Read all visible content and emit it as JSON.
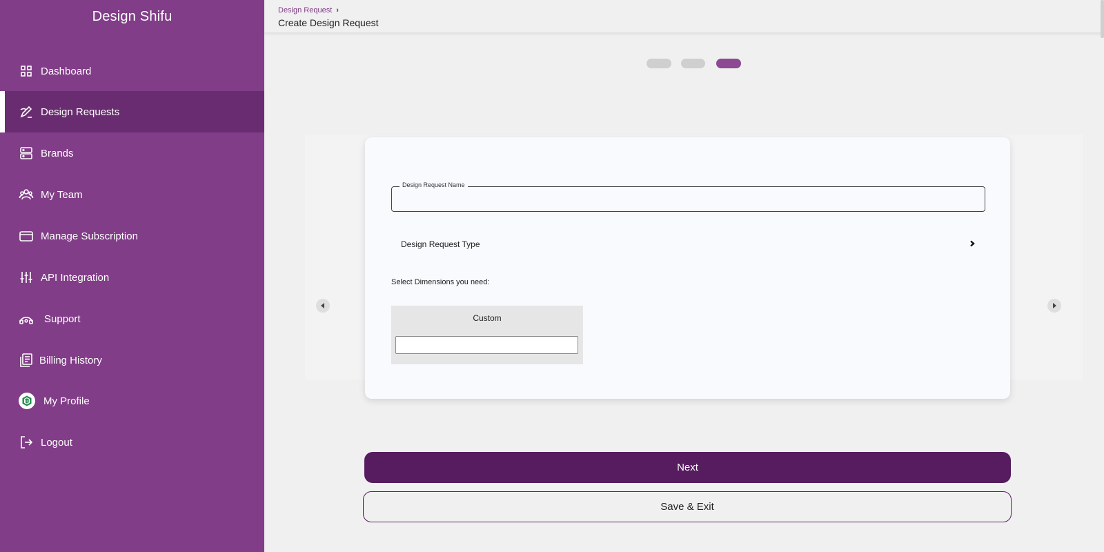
{
  "app": {
    "brand": "Design Shifu"
  },
  "sidebar": {
    "items": [
      {
        "label": "Dashboard",
        "icon": "grid-icon"
      },
      {
        "label": "Design Requests",
        "icon": "pen-icon",
        "active": true
      },
      {
        "label": "Brands",
        "icon": "server-icon"
      },
      {
        "label": "My Team",
        "icon": "team-icon"
      },
      {
        "label": "Manage Subscription",
        "icon": "card-icon"
      },
      {
        "label": "API Integration",
        "icon": "sliders-icon"
      },
      {
        "label": "Support",
        "icon": "headset-icon"
      },
      {
        "label": "Billing History",
        "icon": "receipt-icon"
      },
      {
        "label": "My Profile",
        "icon": "avatar"
      },
      {
        "label": "Logout",
        "icon": "logout-icon"
      }
    ]
  },
  "header": {
    "breadcrumb": "Design Request",
    "title": "Create Design Request"
  },
  "stepper": {
    "total": 3,
    "current": 3
  },
  "form": {
    "name_label": "Design Request Name",
    "name_value": "",
    "type_label": "Design Request Type",
    "dimensions_label": "Select Dimensions you need:",
    "custom_label": "Custom",
    "custom_value": ""
  },
  "actions": {
    "next_label": "Next",
    "save_exit_label": "Save & Exit"
  },
  "colors": {
    "sidebar_bg": "#813d87",
    "sidebar_active": "#6a2c70",
    "primary": "#561c5f",
    "step_active": "#8b4a91"
  }
}
